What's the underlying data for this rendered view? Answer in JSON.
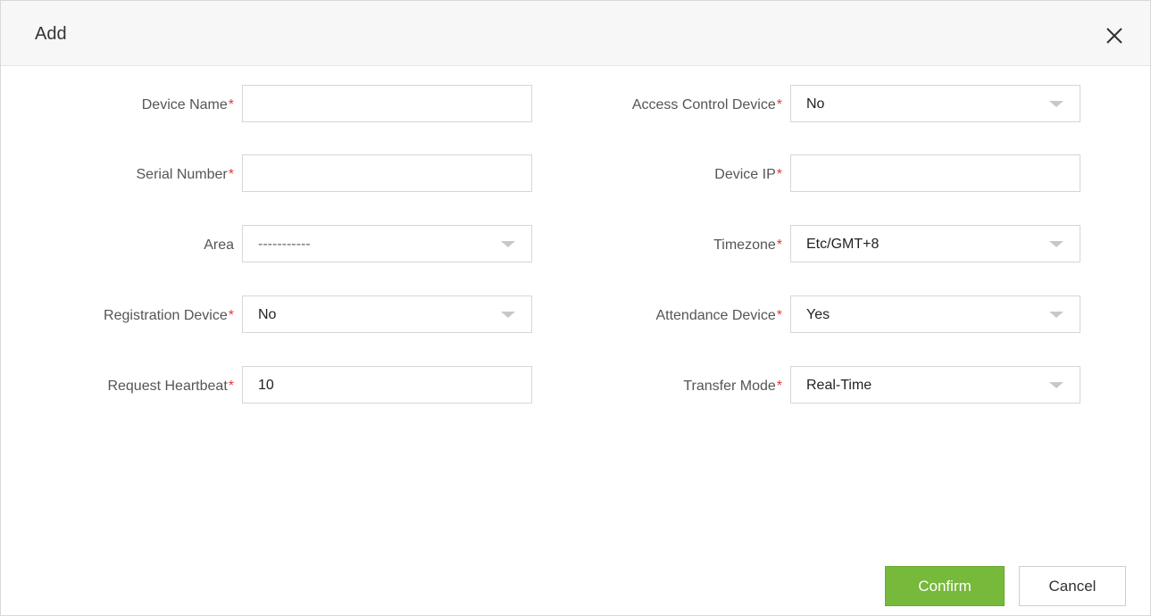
{
  "dialog": {
    "title": "Add",
    "close_icon": "close-icon"
  },
  "fields": {
    "device_name": {
      "label": "Device Name",
      "required_mark": "*",
      "value": ""
    },
    "serial_number": {
      "label": "Serial Number",
      "required_mark": "*",
      "value": ""
    },
    "area": {
      "label": "Area",
      "value": "-----------"
    },
    "registration_device": {
      "label": "Registration Device",
      "required_mark": "*",
      "value": "No"
    },
    "request_heartbeat": {
      "label": "Request Heartbeat",
      "required_mark": "*",
      "value": "10"
    },
    "access_control_device": {
      "label": "Access Control Device",
      "required_mark": "*",
      "value": "No"
    },
    "device_ip": {
      "label": "Device IP",
      "required_mark": "*",
      "value": ""
    },
    "timezone": {
      "label": "Timezone",
      "required_mark": "*",
      "value": "Etc/GMT+8"
    },
    "attendance_device": {
      "label": "Attendance Device",
      "required_mark": "*",
      "value": "Yes"
    },
    "transfer_mode": {
      "label": "Transfer Mode",
      "required_mark": "*",
      "value": "Real-Time"
    }
  },
  "buttons": {
    "confirm": "Confirm",
    "cancel": "Cancel"
  },
  "colors": {
    "confirm_bg": "#76b93b",
    "required": "#e4393c",
    "header_bg": "#f7f7f7"
  }
}
